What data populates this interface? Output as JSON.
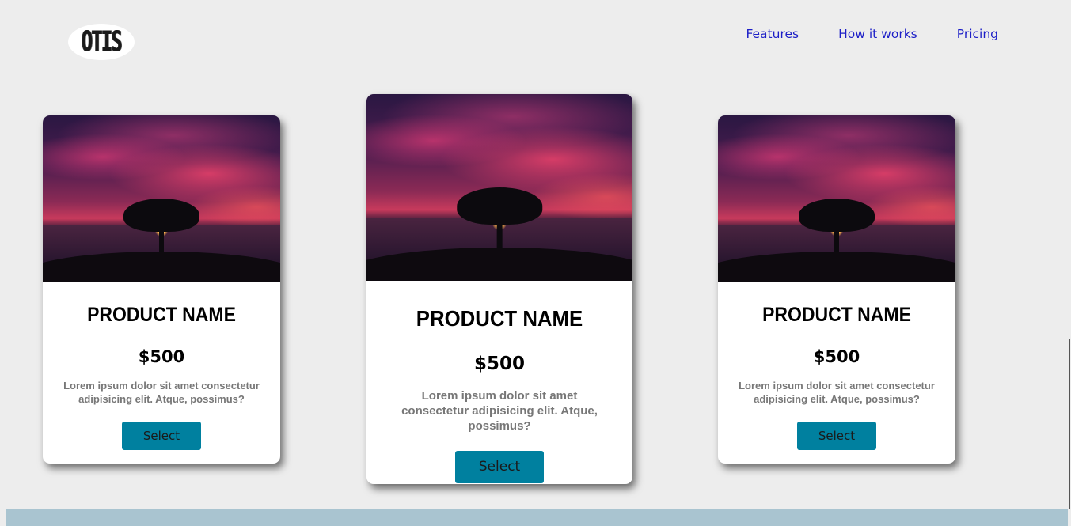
{
  "brand": {
    "logo_text": "OTIS"
  },
  "nav": {
    "items": [
      {
        "label": "Features"
      },
      {
        "label": "How it works"
      },
      {
        "label": "Pricing"
      }
    ]
  },
  "cards": [
    {
      "title": "PRODUCT NAME",
      "price": "$500",
      "description": "Lorem ipsum dolor sit amet consectetur adipisicing elit. Atque, possimus?",
      "button_label": "Select"
    },
    {
      "title": "PRODUCT NAME",
      "price": "$500",
      "description": "Lorem ipsum dolor sit amet consectetur adipisicing elit. Atque, possimus?",
      "button_label": "Select",
      "featured": true
    },
    {
      "title": "PRODUCT NAME",
      "price": "$500",
      "description": "Lorem ipsum dolor sit amet consectetur adipisicing elit. Atque, possimus?",
      "button_label": "Select"
    }
  ],
  "colors": {
    "background": "#ededed",
    "nav_link": "#1d1fc7",
    "button": "#00809f",
    "footer_bar": "#a9c4d0"
  },
  "icons": {
    "card_image": "sunset-tree-image"
  }
}
